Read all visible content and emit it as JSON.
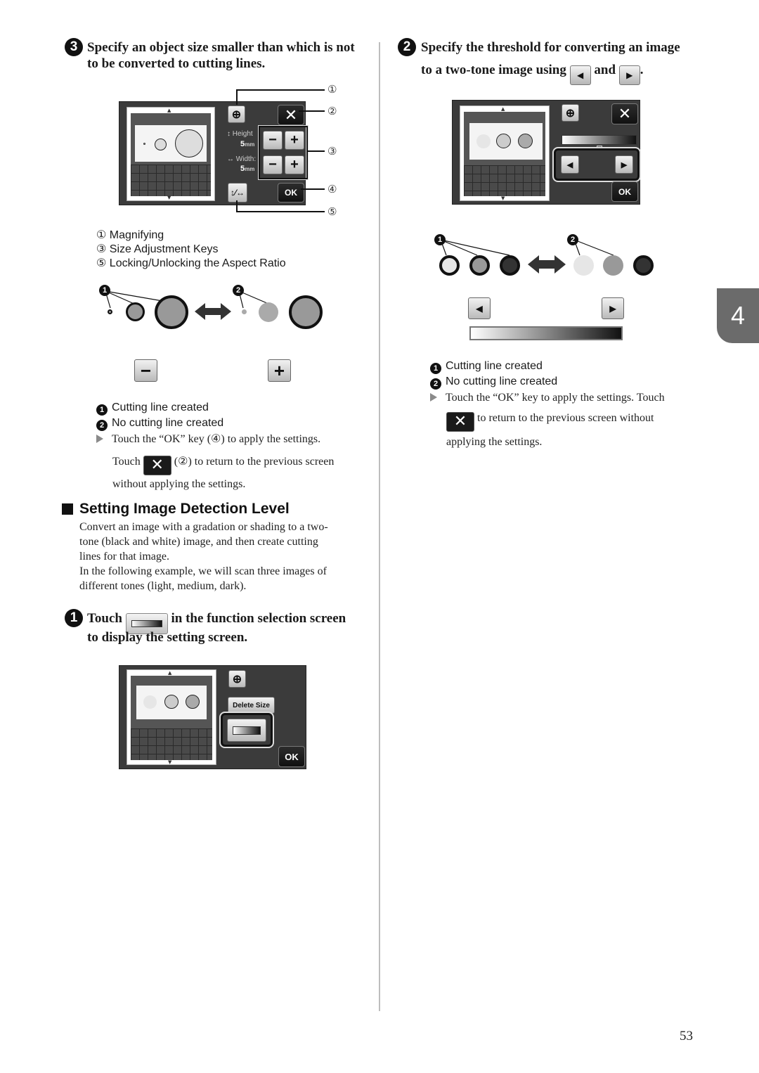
{
  "left_column": {
    "step3": {
      "number": "3",
      "line1": "Specify an object size smaller than which is not",
      "line2": "to be converted to cutting lines."
    },
    "screen1": {
      "height_label": "Height",
      "height_value": "5",
      "height_unit": "mm",
      "width_label": "Width:",
      "width_value": "5",
      "width_unit": "mm",
      "ok_label": "OK",
      "minus_symbol": "−",
      "plus_symbol": "+",
      "close_symbol": "✕",
      "callouts": [
        "①",
        "②",
        "③",
        "④",
        "⑤"
      ]
    },
    "legend_items": [
      {
        "num": "①",
        "label": "Magnifying"
      },
      {
        "num": "③",
        "label": "Size Adjustment Keys"
      },
      {
        "num": "⑤",
        "label": "Locking/Unlocking the Aspect Ratio"
      }
    ],
    "diagram1": {
      "marker1": "1",
      "marker2": "2",
      "minus_symbol": "−",
      "plus_symbol": "+"
    },
    "result_legend": {
      "item1": "Cutting line created",
      "item2": "No cutting line created",
      "item1_num": "1",
      "item2_num": "2"
    },
    "instructions": {
      "line1": "Touch the “OK” key (④) to apply the settings.",
      "line2_pre": "Touch",
      "line2_post": "(②) to return to the previous screen",
      "line3": "without applying the settings.",
      "close_symbol": "✕"
    },
    "section": {
      "title": "Setting Image Detection Level",
      "para1_l1": "Convert an image with a gradation or shading to a two-",
      "para1_l2": "tone (black and white) image, and then create cutting",
      "para1_l3": "lines for that image.",
      "para2_l1": "In the following example, we will scan three images of",
      "para2_l2": "different tones (light, medium, dark)."
    },
    "step1": {
      "number": "1",
      "pre": "Touch",
      "post": "in the function selection screen",
      "line2": "to display the setting screen."
    },
    "screen3": {
      "delete_size_label": "Delete Size",
      "ok_label": "OK"
    }
  },
  "right_column": {
    "step2": {
      "number": "2",
      "line1": "Specify the threshold for converting an image",
      "line2_pre": "to a two-tone image using",
      "line2_and": "and",
      "line2_end": ".",
      "left_arrow": "◀",
      "right_arrow": "▶"
    },
    "screen2": {
      "ok_label": "OK",
      "close_symbol": "✕",
      "left_arrow": "◀",
      "right_arrow": "▶"
    },
    "diagram2": {
      "marker1": "1",
      "marker2": "2",
      "left_arrow": "◀",
      "right_arrow": "▶"
    },
    "result_legend": {
      "item1": "Cutting line created",
      "item2": "No cutting line created",
      "item1_num": "1",
      "item2_num": "2"
    },
    "instructions": {
      "line1": "Touch the “OK” key to apply the settings. Touch",
      "line2": "to return to the previous screen without",
      "line3": "applying the settings.",
      "close_symbol": "✕"
    }
  },
  "chapter_tab": "4",
  "page_number": "53"
}
